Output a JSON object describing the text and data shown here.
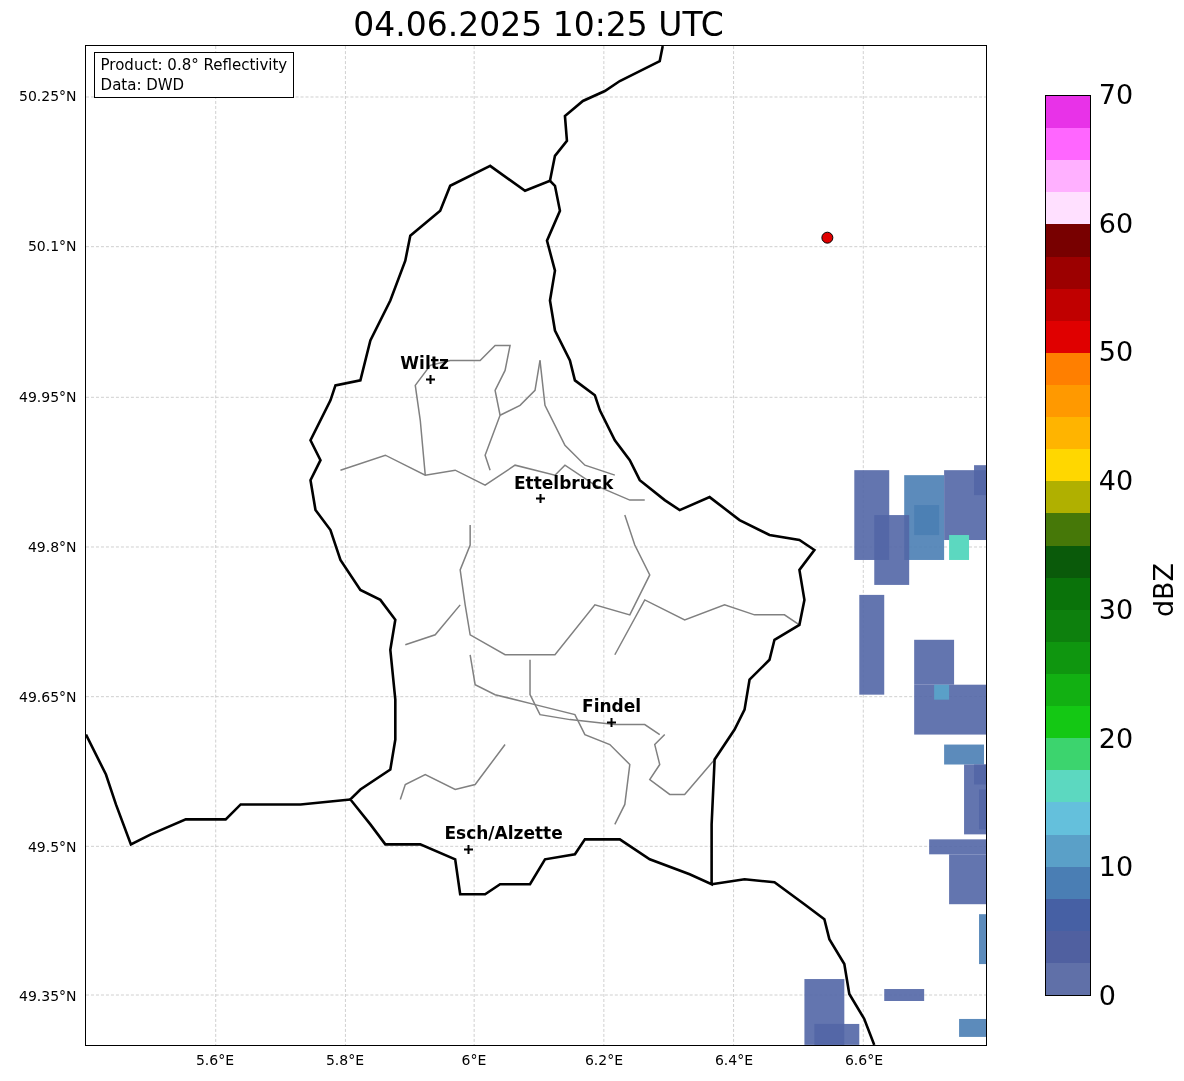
{
  "title": "04.06.2025 10:25 UTC",
  "info_box": [
    "Product: 0.8° Reflectivity",
    "Data: DWD"
  ],
  "map": {
    "lat_ticks": [
      "50.25°N",
      "50.1°N",
      "49.95°N",
      "49.8°N",
      "49.65°N",
      "49.5°N",
      "49.35°N"
    ],
    "lon_ticks": [
      "5.6°E",
      "5.8°E",
      "6°E",
      "6.2°E",
      "6.4°E",
      "6.6°E"
    ],
    "cities": [
      {
        "name": "Wiltz"
      },
      {
        "name": "Ettelbruck"
      },
      {
        "name": "Findel"
      },
      {
        "name": "Esch/Alzette"
      }
    ]
  },
  "colorbar": {
    "ticks": [
      "70",
      "60",
      "50",
      "40",
      "30",
      "20",
      "10",
      "0"
    ],
    "label": "dBZ"
  }
}
